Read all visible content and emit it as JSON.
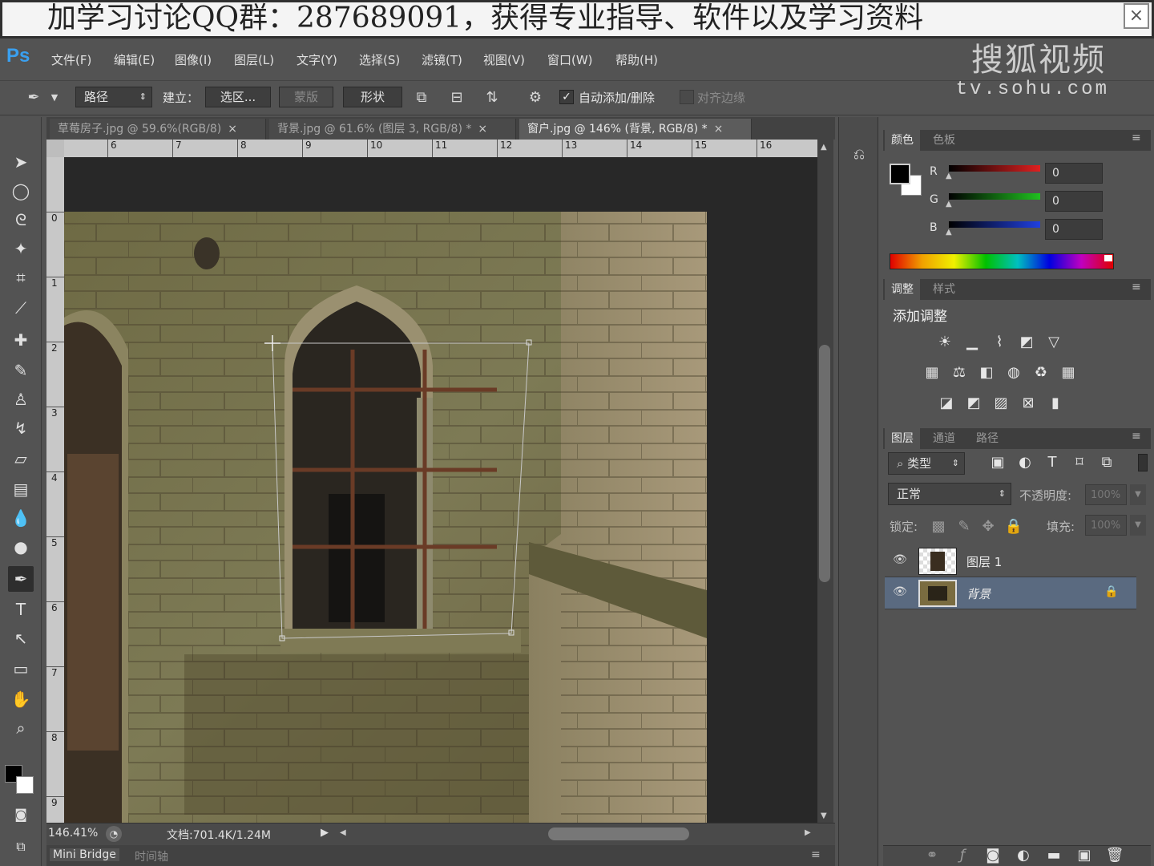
{
  "banner": {
    "text": "加学习讨论QQ群：287689091，获得专业指导、软件以及学习资料",
    "close": "×"
  },
  "watermark": {
    "brand": "搜狐视频",
    "url": "tv.sohu.com"
  },
  "app": {
    "logo": "Ps"
  },
  "menu": [
    "文件(F)",
    "编辑(E)",
    "图像(I)",
    "图层(L)",
    "文字(Y)",
    "选择(S)",
    "滤镜(T)",
    "视图(V)",
    "窗口(W)",
    "帮助(H)"
  ],
  "options": {
    "mode": "路径",
    "build_label": "建立：",
    "selection_btn": "选区...",
    "mask_btn": "蒙版",
    "shape_btn": "形状",
    "auto_add_label": "自动添加/删除",
    "auto_add_checked": true,
    "align_edges_label": "对齐边缘",
    "align_edges_checked": false
  },
  "tabs": [
    {
      "title": "草莓房子.jpg @ 59.6%(RGB/8)",
      "close": "×",
      "active": false
    },
    {
      "title": "背景.jpg @ 61.6% (图层 3, RGB/8) *",
      "close": "×",
      "active": false
    },
    {
      "title": "窗户.jpg @ 146% (背景, RGB/8) *",
      "close": "×",
      "active": true
    }
  ],
  "ruler": {
    "h_ticks": [
      "6",
      "7",
      "8",
      "9",
      "10",
      "11",
      "12",
      "13",
      "14",
      "15",
      "16"
    ],
    "v_ticks": [
      "0",
      "1",
      "2",
      "3",
      "4",
      "5",
      "6",
      "7",
      "8",
      "9"
    ]
  },
  "status": {
    "zoom": "146.41%",
    "doc": "文档:701.4K/1.24M"
  },
  "bottom_tabs": [
    "Mini Bridge",
    "时间轴"
  ],
  "color_panel": {
    "tabs": [
      "颜色",
      "色板"
    ],
    "channels": [
      {
        "label": "R",
        "value": "0",
        "color": "#e02020"
      },
      {
        "label": "G",
        "value": "0",
        "color": "#20c020"
      },
      {
        "label": "B",
        "value": "0",
        "color": "#2040e0"
      }
    ]
  },
  "adjust_panel": {
    "tabs": [
      "调整",
      "样式"
    ],
    "heading": "添加调整"
  },
  "layers_panel": {
    "tabs": [
      "图层",
      "通道",
      "路径"
    ],
    "filter_kind": "类型",
    "blend_mode": "正常",
    "opacity_label": "不透明度:",
    "opacity_value": "100%",
    "lock_label": "锁定:",
    "fill_label": "填充:",
    "fill_value": "100%",
    "layers": [
      {
        "name": "图层 1",
        "selected": false,
        "locked": false
      },
      {
        "name": "背景",
        "selected": true,
        "locked": true
      }
    ]
  },
  "colors": {
    "accent": "#3aa0f0",
    "selected_layer": "#5a6a80",
    "panel_bg": "#535353"
  }
}
